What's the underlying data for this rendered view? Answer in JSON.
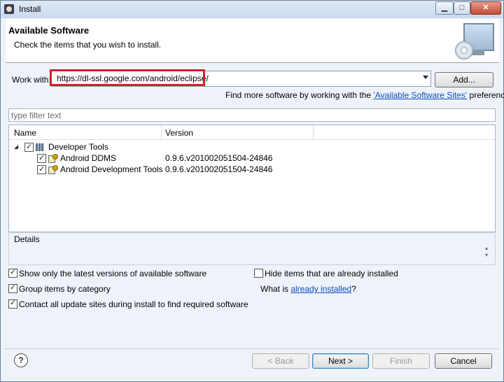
{
  "window": {
    "title": "Install",
    "minimize": "▁",
    "maximize": "□",
    "close": "✕"
  },
  "header": {
    "title": "Available Software",
    "description": "Check the items that you wish to install."
  },
  "work_with": {
    "label": "Work with:",
    "value": "https://dl-ssl.google.com/android/eclipse/",
    "add_button": "Add...",
    "hint_prefix": "Find more software by working with the ",
    "hint_link": "'Available Software Sites'",
    "hint_suffix": " preferences."
  },
  "filter": {
    "placeholder": "type filter text"
  },
  "tree": {
    "columns": [
      "Name",
      "Version"
    ],
    "category": {
      "name": "Developer Tools",
      "checked": true,
      "expand_glyph": "◢"
    },
    "items": [
      {
        "name": "Android DDMS",
        "version": "0.9.6.v201002051504-24846",
        "checked": true
      },
      {
        "name": "Android Development Tools",
        "version": "0.9.6.v201002051504-24846",
        "checked": true
      }
    ]
  },
  "details": {
    "label": "Details",
    "scroll_up": "▴",
    "scroll_down": "▾"
  },
  "options": {
    "show_latest": {
      "label": "Show only the latest versions of available software",
      "checked": true
    },
    "hide_installed": {
      "label": "Hide items that are already installed",
      "checked": false
    },
    "group_by_category": {
      "label": "Group items by category",
      "checked": true
    },
    "already_installed_prefix": "What is ",
    "already_installed_link": "already installed",
    "already_installed_suffix": "?",
    "contact_sites": {
      "label": "Contact all update sites during install to find required software",
      "checked": true
    }
  },
  "footer": {
    "help": "?",
    "back": "< Back",
    "next": "Next >",
    "finish": "Finish",
    "cancel": "Cancel"
  },
  "colors": {
    "highlight_border": "#d4202a",
    "link": "#0b4bbf"
  }
}
